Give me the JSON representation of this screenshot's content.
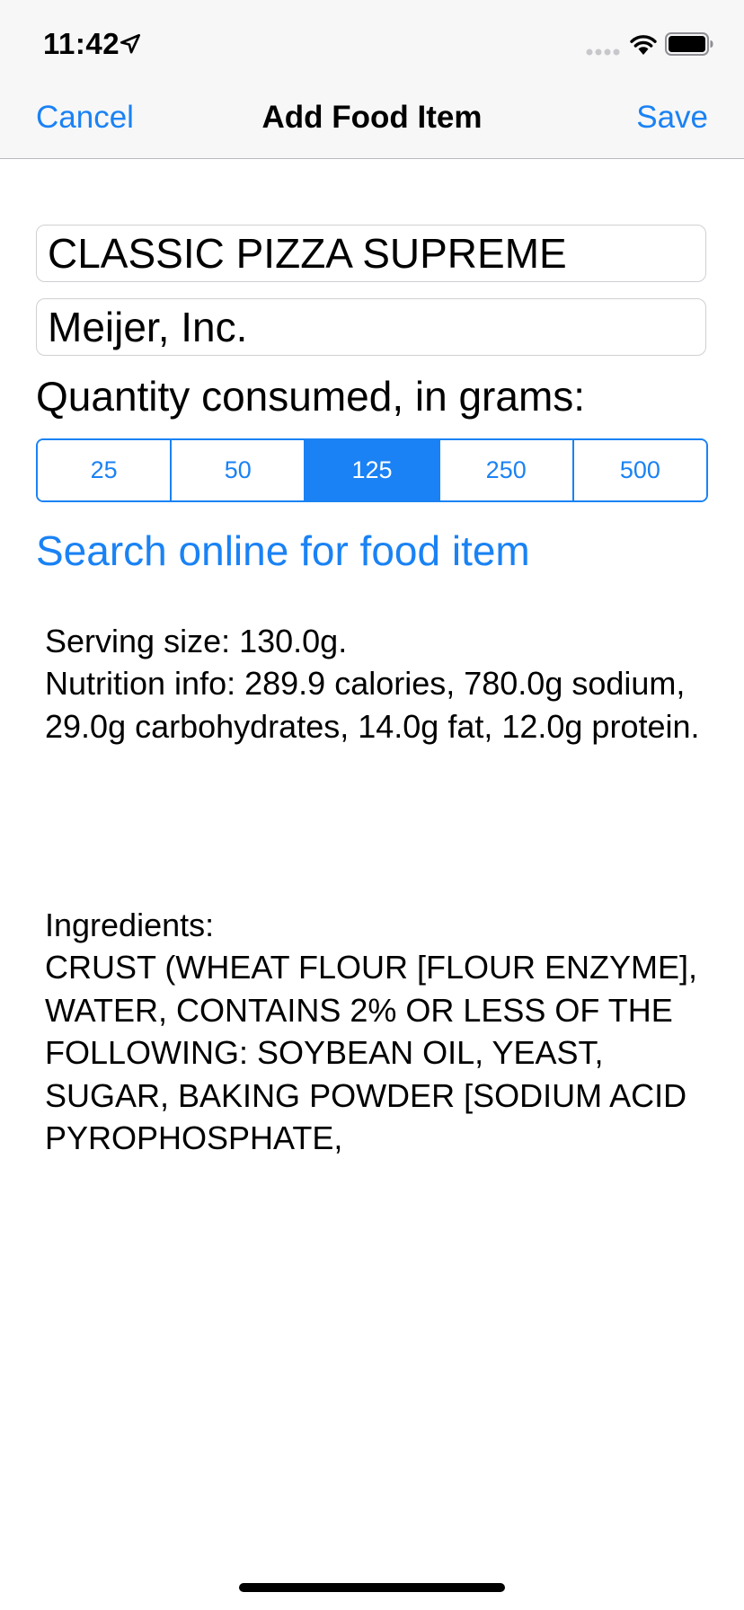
{
  "status_bar": {
    "time": "11:42"
  },
  "nav": {
    "cancel_label": "Cancel",
    "title": "Add Food Item",
    "save_label": "Save"
  },
  "form": {
    "food_name": "CLASSIC PIZZA SUPREME",
    "brand": "Meijer, Inc.",
    "quantity_label": "Quantity consumed, in grams:",
    "quantity_options": [
      "25",
      "50",
      "125",
      "250",
      "500"
    ],
    "selected_quantity": "125",
    "search_link": "Search online for food item"
  },
  "info": {
    "serving": "Serving size: 130.0g.",
    "nutrition": "Nutrition info: 289.9 calories, 780.0g sodium, 29.0g carbohydrates, 14.0g fat, 12.0g protein.",
    "ingredients_label": "Ingredients:",
    "ingredients": "CRUST (WHEAT FLOUR [FLOUR ENZYME], WATER, CONTAINS 2% OR LESS OF THE FOLLOWING: SOYBEAN OIL, YEAST, SUGAR, BAKING POWDER [SODIUM ACID PYROPHOSPHATE,"
  },
  "colors": {
    "accent": "#1a82f4",
    "nav_background": "#f7f7f8"
  },
  "icons": [
    "location-arrow-icon",
    "cellular-signal-icon",
    "wifi-icon",
    "battery-icon"
  ]
}
